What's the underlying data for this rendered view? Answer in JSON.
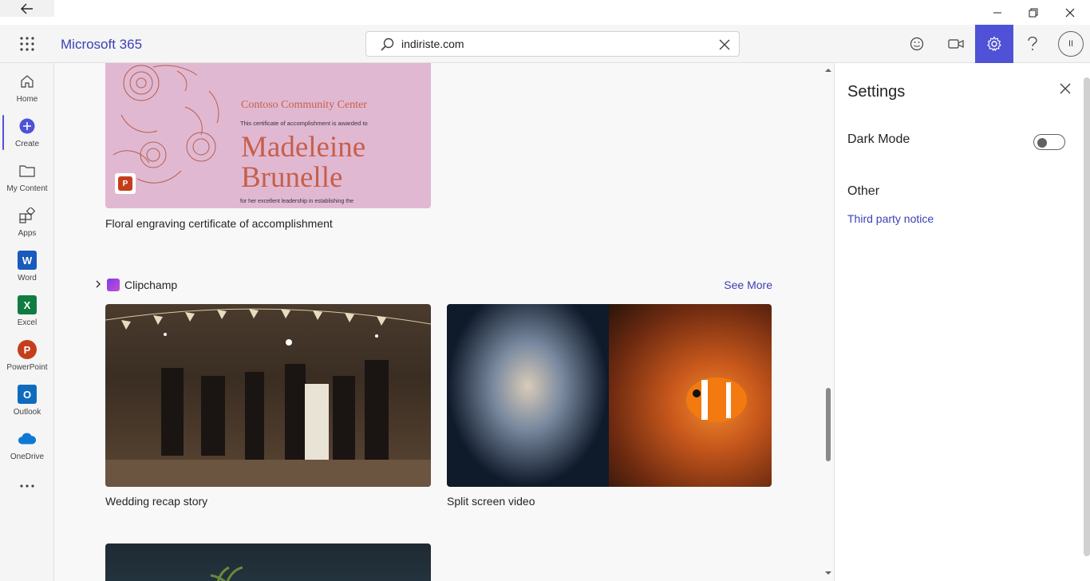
{
  "header": {
    "brand": "Microsoft 365",
    "search_value": "indiriste.com",
    "avatar_initials": "II"
  },
  "rail": {
    "items": [
      {
        "label": "Home"
      },
      {
        "label": "Create"
      },
      {
        "label": "My Content"
      },
      {
        "label": "Apps"
      },
      {
        "label": "Word"
      },
      {
        "label": "Excel"
      },
      {
        "label": "PowerPoint"
      },
      {
        "label": "Outlook"
      },
      {
        "label": "OneDrive"
      }
    ]
  },
  "main": {
    "certificate": {
      "title": "Floral engraving certificate of accomplishment",
      "org": "Contoso Community Center",
      "award_line": "This certificate of accomplishment is awarded to",
      "name_line1": "Madeleine",
      "name_line2": "Brunelle",
      "leadership_line": "for her excellent leadership in establishing the"
    },
    "section": {
      "name": "Clipchamp",
      "see_more": "See More"
    },
    "cards": [
      {
        "title": "Wedding recap story"
      },
      {
        "title": "Split screen video"
      }
    ]
  },
  "settings": {
    "title": "Settings",
    "dark_mode_label": "Dark Mode",
    "dark_mode_on": false,
    "other_label": "Other",
    "third_party_notice": "Third party notice"
  },
  "colors": {
    "accent": "#4f52d6",
    "link": "#3b3fb6",
    "word": "#185abd",
    "excel": "#107c41",
    "powerpoint": "#c43e1c",
    "outlook": "#0f6cbd",
    "onedrive": "#0f78d4"
  }
}
